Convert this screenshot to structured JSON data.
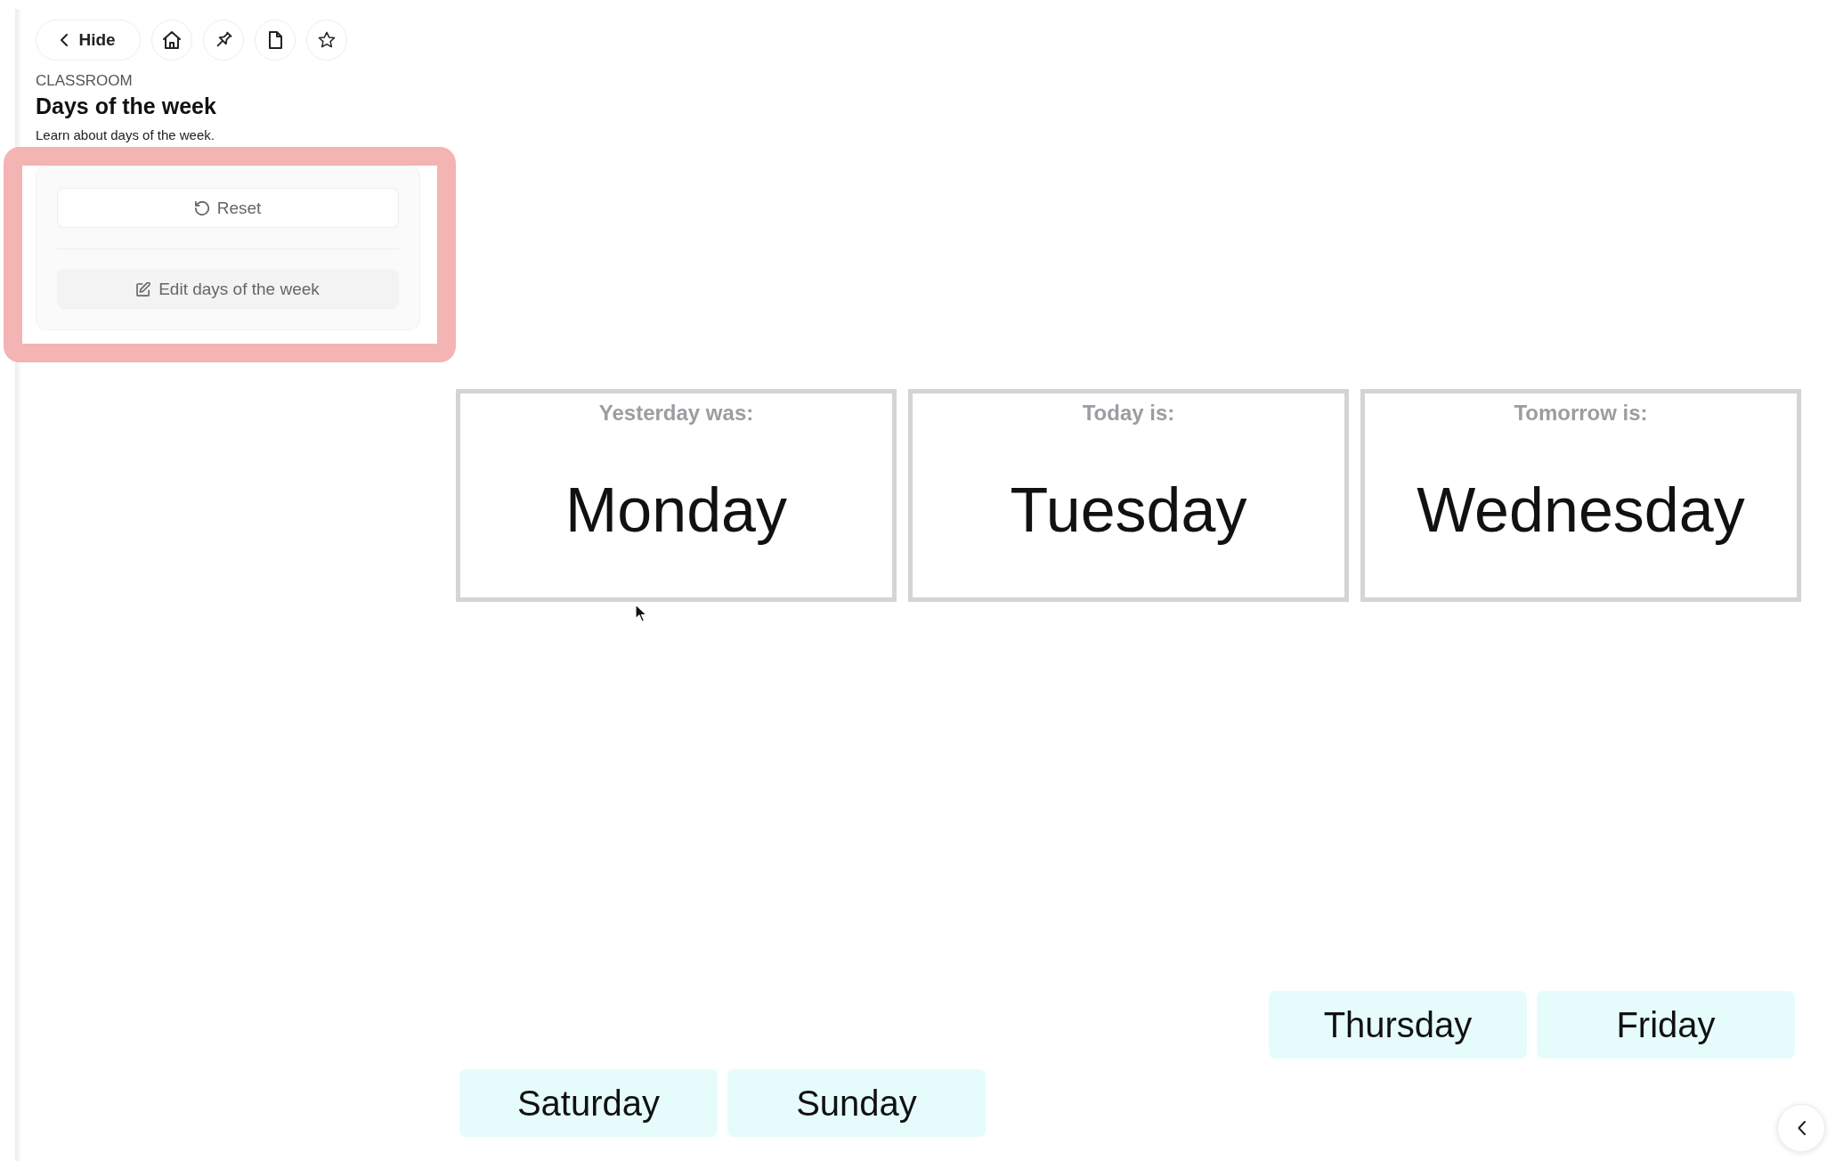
{
  "toolbar": {
    "hide_button": "Hide"
  },
  "header": {
    "category": "CLASSROOM",
    "title": "Days of the week",
    "description": "Learn about days of the week."
  },
  "panel": {
    "buttons": [
      {
        "kind": "reset",
        "label": "Reset"
      },
      {
        "kind": "edit",
        "label": "Edit days of the week"
      }
    ]
  },
  "day_cards": [
    {
      "label": "Yesterday was:",
      "day": "Monday"
    },
    {
      "label": "Today is:",
      "day": "Tuesday"
    },
    {
      "label": "Tomorrow is:",
      "day": "Wednesday"
    }
  ],
  "day_chips": {
    "upper_row": [
      "Thursday",
      "Friday"
    ],
    "lower_row": [
      "Saturday",
      "Sunday"
    ]
  }
}
